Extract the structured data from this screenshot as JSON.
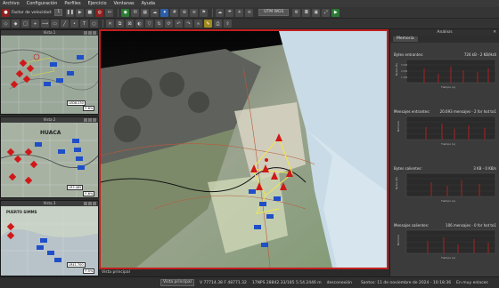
{
  "menu": [
    "Archivo",
    "Configuración",
    "Perfiles",
    "Ejercicio",
    "Ventanas",
    "Ayuda"
  ],
  "toolbar": {
    "speed_label": "Factor de velocidad:",
    "speed_value": "1",
    "coord_select": "UTM WGS"
  },
  "views": [
    {
      "title": "Vista 1",
      "label": "LED8.230",
      "label2": "Ƴ.6%"
    },
    {
      "title": "Vista 2",
      "place": "HUACA",
      "label": "LR3.465",
      "label2": "Ƴ.6%"
    },
    {
      "title": "Vista 3",
      "place": "PUERTO SIMMS",
      "label": "LR41.700",
      "label2": "Ƴ.5%"
    }
  ],
  "main": {
    "footer": "Vista principal"
  },
  "analysis": {
    "title": "Análisis",
    "tab": "Memoria",
    "metrics": [
      {
        "name": "Bytes entrantes:",
        "value": "726 kB - 2 KB/Hz0",
        "ylabel": "Bytes (B)",
        "xlabel": "Tiempo (s)",
        "yticks": [
          "3 000",
          "2 000",
          "1 000",
          "0"
        ]
      },
      {
        "name": "Mensajes entrantes:",
        "value": "20.693 mensajes - 2 for hot to1",
        "ylabel": "Número",
        "xlabel": "Tiempo (s)",
        "yticks": [
          "60",
          "40",
          "20",
          "0"
        ]
      },
      {
        "name": "Bytes salientes:",
        "value": "3 KB - 0 KB/s",
        "ylabel": "Bytes (B)",
        "xlabel": "Tiempo (s)",
        "yticks": [
          "60",
          "40",
          "20",
          "0"
        ]
      },
      {
        "name": "Mensajes salientes:",
        "value": "106 mensajes - 0 for hot to1",
        "ylabel": "Número",
        "xlabel": "Tiempo (s)",
        "yticks": [
          "3",
          "2",
          "1",
          "0"
        ]
      }
    ]
  },
  "status": {
    "view_label": "Vista principal",
    "coords": "V 77714.38 F 48771.32",
    "utm": "17NPS 28842.33/185 5.54.2446 m",
    "state": "desconexión",
    "right": "Santos: 11 de noviembre de 2024 - 10:18:36",
    "mode": "En muy enlaces"
  },
  "colors": {
    "accent_red": "#c21f1f",
    "panel": "#3b3b3b",
    "chart_bar": "#cc2020"
  }
}
